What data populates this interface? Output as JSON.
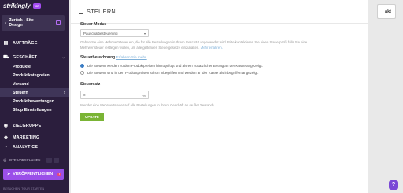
{
  "sidebar": {
    "brand": "strikingly",
    "vip_badge": "VIP",
    "back": {
      "label": "Zurück - Site Design"
    },
    "nav": [
      {
        "label": "AUFTRÄGE",
        "icon": "receipt-icon"
      },
      {
        "label": "GESCHÄFT",
        "icon": "cart-icon"
      }
    ],
    "shop_sub": [
      "Produkte",
      "Produktkategorien",
      "Versand",
      "Steuern",
      "Produktbewertungen",
      "Shop Einstellungen"
    ],
    "nav_lower": [
      {
        "label": "ZIELGRUPPE",
        "icon": "audience-icon"
      },
      {
        "label": "MARKETING",
        "icon": "megaphone-icon"
      },
      {
        "label": "ANALYTICS",
        "icon": "analytics-icon"
      }
    ],
    "site_preview": "SITE VORSCHAUEN",
    "publish": "VERÖFFENTLICHEN",
    "publish_badge": "!",
    "footer": "BESUCHEN: TOUR STARTEN"
  },
  "backdrop": {
    "right_button": "akt",
    "help": "?"
  },
  "modal": {
    "title": "STEUERN",
    "tax_mode": {
      "label": "Steuer-Modus",
      "value": "Pauschalbesteuerung",
      "description": "Geben Sie eine Mehrwertsteuer ein, die für alle Bestellungen in Ihrem Geschäft angewendet wird. Bitte kontaktieren Sie einen Steuerprofi, falls Sie eine Mehrwertsteuer festlegen wollen, um alle geltenden Steuergesetze einzuhalten.",
      "link": "Mehr erfahren."
    },
    "tax_calc": {
      "label": "Steuerberechnung",
      "link": "Erfahren Sie mehr.",
      "options": [
        "Die Steuern werden zu den Produktpreisen hinzugefügt und als ein zusätzlicher Betrag an der Kasse angezeigt.",
        "Die Steuern sind in den Produktpreisen schon inbegriffen und werden an der Kasse als inbegriffen angezeigt."
      ],
      "selected_index": 0
    },
    "tax_rate": {
      "label": "Steuersatz",
      "value": "0",
      "unit": "%",
      "description": "Wendet eine Mehrwertsteuer auf alle Bestellungen in Ihrem Geschäft an (außer Versand)."
    },
    "update_button": "UPDATE"
  }
}
